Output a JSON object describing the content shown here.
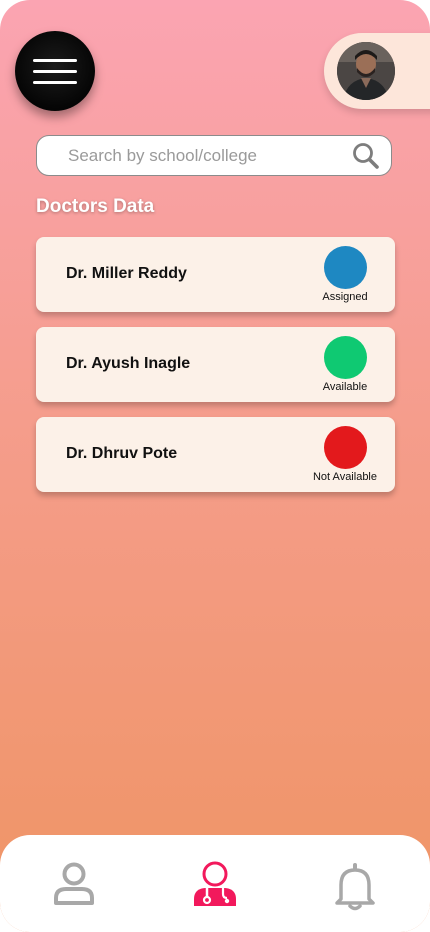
{
  "search": {
    "placeholder": "Search by school/college"
  },
  "section_title": "Doctors Data",
  "doctors": [
    {
      "name": "Dr. Miller Reddy",
      "status": "Assigned",
      "status_color": "#1e88c2"
    },
    {
      "name": "Dr. Ayush Inagle",
      "status": "Available",
      "status_color": "#0fc972"
    },
    {
      "name": "Dr. Dhruv Pote",
      "status": "Not Available",
      "status_color": "#e3191c"
    }
  ],
  "colors": {
    "active_nav": "#f2195c",
    "inactive_nav": "#a8a8a8"
  },
  "nav": [
    {
      "icon": "user-icon",
      "active": false
    },
    {
      "icon": "doctor-icon",
      "active": true
    },
    {
      "icon": "bell-icon",
      "active": false
    }
  ]
}
